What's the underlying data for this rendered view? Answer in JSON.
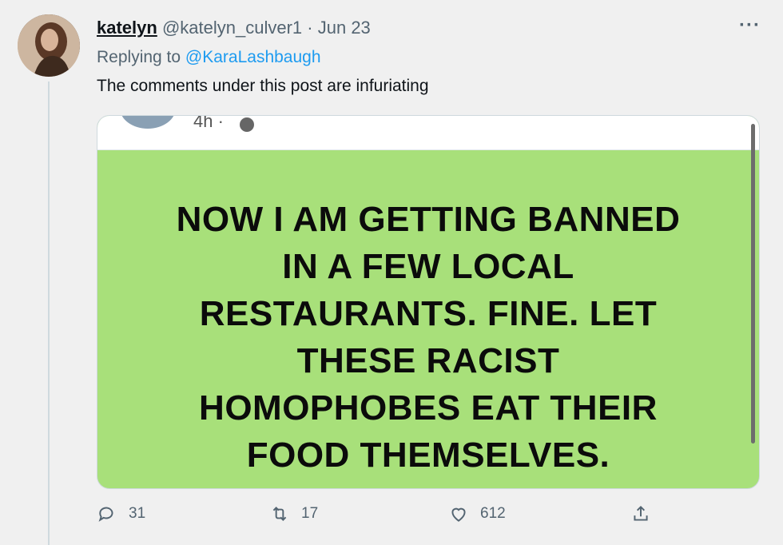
{
  "tweet": {
    "display_name": "katelyn",
    "handle": "@katelyn_culver1",
    "separator": "·",
    "date": "Jun 23",
    "replying_to_prefix": "Replying to",
    "replying_to_handle": "@KaraLashbaugh",
    "text": "The comments under this post are infuriating"
  },
  "media": {
    "time": "4h ·",
    "banner_text": "NOW I AM GETTING BANNED\nIN A FEW LOCAL\nRESTAURANTS. FINE. LET\nTHESE RACIST\nHOMOPHOBES EAT THEIR\nFOOD THEMSELVES.",
    "background_color": "#a8e07a"
  },
  "actions": {
    "reply_count": "31",
    "retweet_count": "17",
    "like_count": "612"
  },
  "icons": {
    "more": "more-icon",
    "reply": "reply-icon",
    "retweet": "retweet-icon",
    "like": "heart-icon",
    "share": "share-icon"
  }
}
